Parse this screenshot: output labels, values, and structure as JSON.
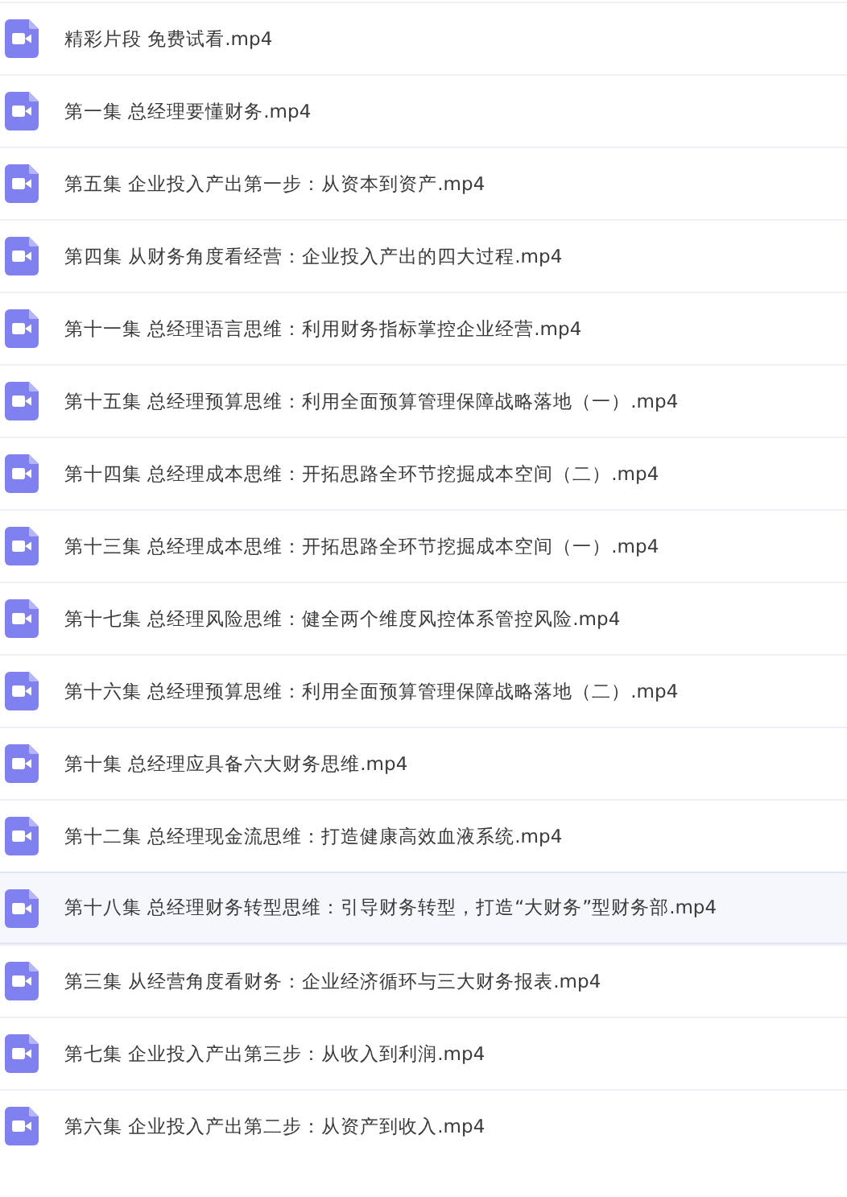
{
  "files": [
    {
      "name": "精彩片段 免费试看.mp4",
      "selected": false
    },
    {
      "name": "第一集 总经理要懂财务.mp4",
      "selected": false
    },
    {
      "name": "第五集 企业投入产出第一步：从资本到资产.mp4",
      "selected": false
    },
    {
      "name": "第四集 从财务角度看经营：企业投入产出的四大过程.mp4",
      "selected": false
    },
    {
      "name": "第十一集 总经理语言思维：利用财务指标掌控企业经营.mp4",
      "selected": false
    },
    {
      "name": "第十五集 总经理预算思维：利用全面预算管理保障战略落地（一）.mp4",
      "selected": false
    },
    {
      "name": "第十四集 总经理成本思维：开拓思路全环节挖掘成本空间（二）.mp4",
      "selected": false
    },
    {
      "name": "第十三集 总经理成本思维：开拓思路全环节挖掘成本空间（一）.mp4",
      "selected": false
    },
    {
      "name": "第十七集 总经理风险思维：健全两个维度风控体系管控风险.mp4",
      "selected": false
    },
    {
      "name": "第十六集 总经理预算思维：利用全面预算管理保障战略落地（二）.mp4",
      "selected": false
    },
    {
      "name": "第十集 总经理应具备六大财务思维.mp4",
      "selected": false
    },
    {
      "name": "第十二集 总经理现金流思维：打造健康高效血液系统.mp4",
      "selected": false
    },
    {
      "name": "第十八集 总经理财务转型思维：引导财务转型，打造“大财务”型财务部.mp4",
      "selected": true
    },
    {
      "name": "第三集 从经营角度看财务：企业经济循环与三大财务报表.mp4",
      "selected": false
    },
    {
      "name": "第七集 企业投入产出第三步：从收入到利润.mp4",
      "selected": false
    },
    {
      "name": "第六集 企业投入产出第二步：从资产到收入.mp4",
      "selected": false
    }
  ]
}
